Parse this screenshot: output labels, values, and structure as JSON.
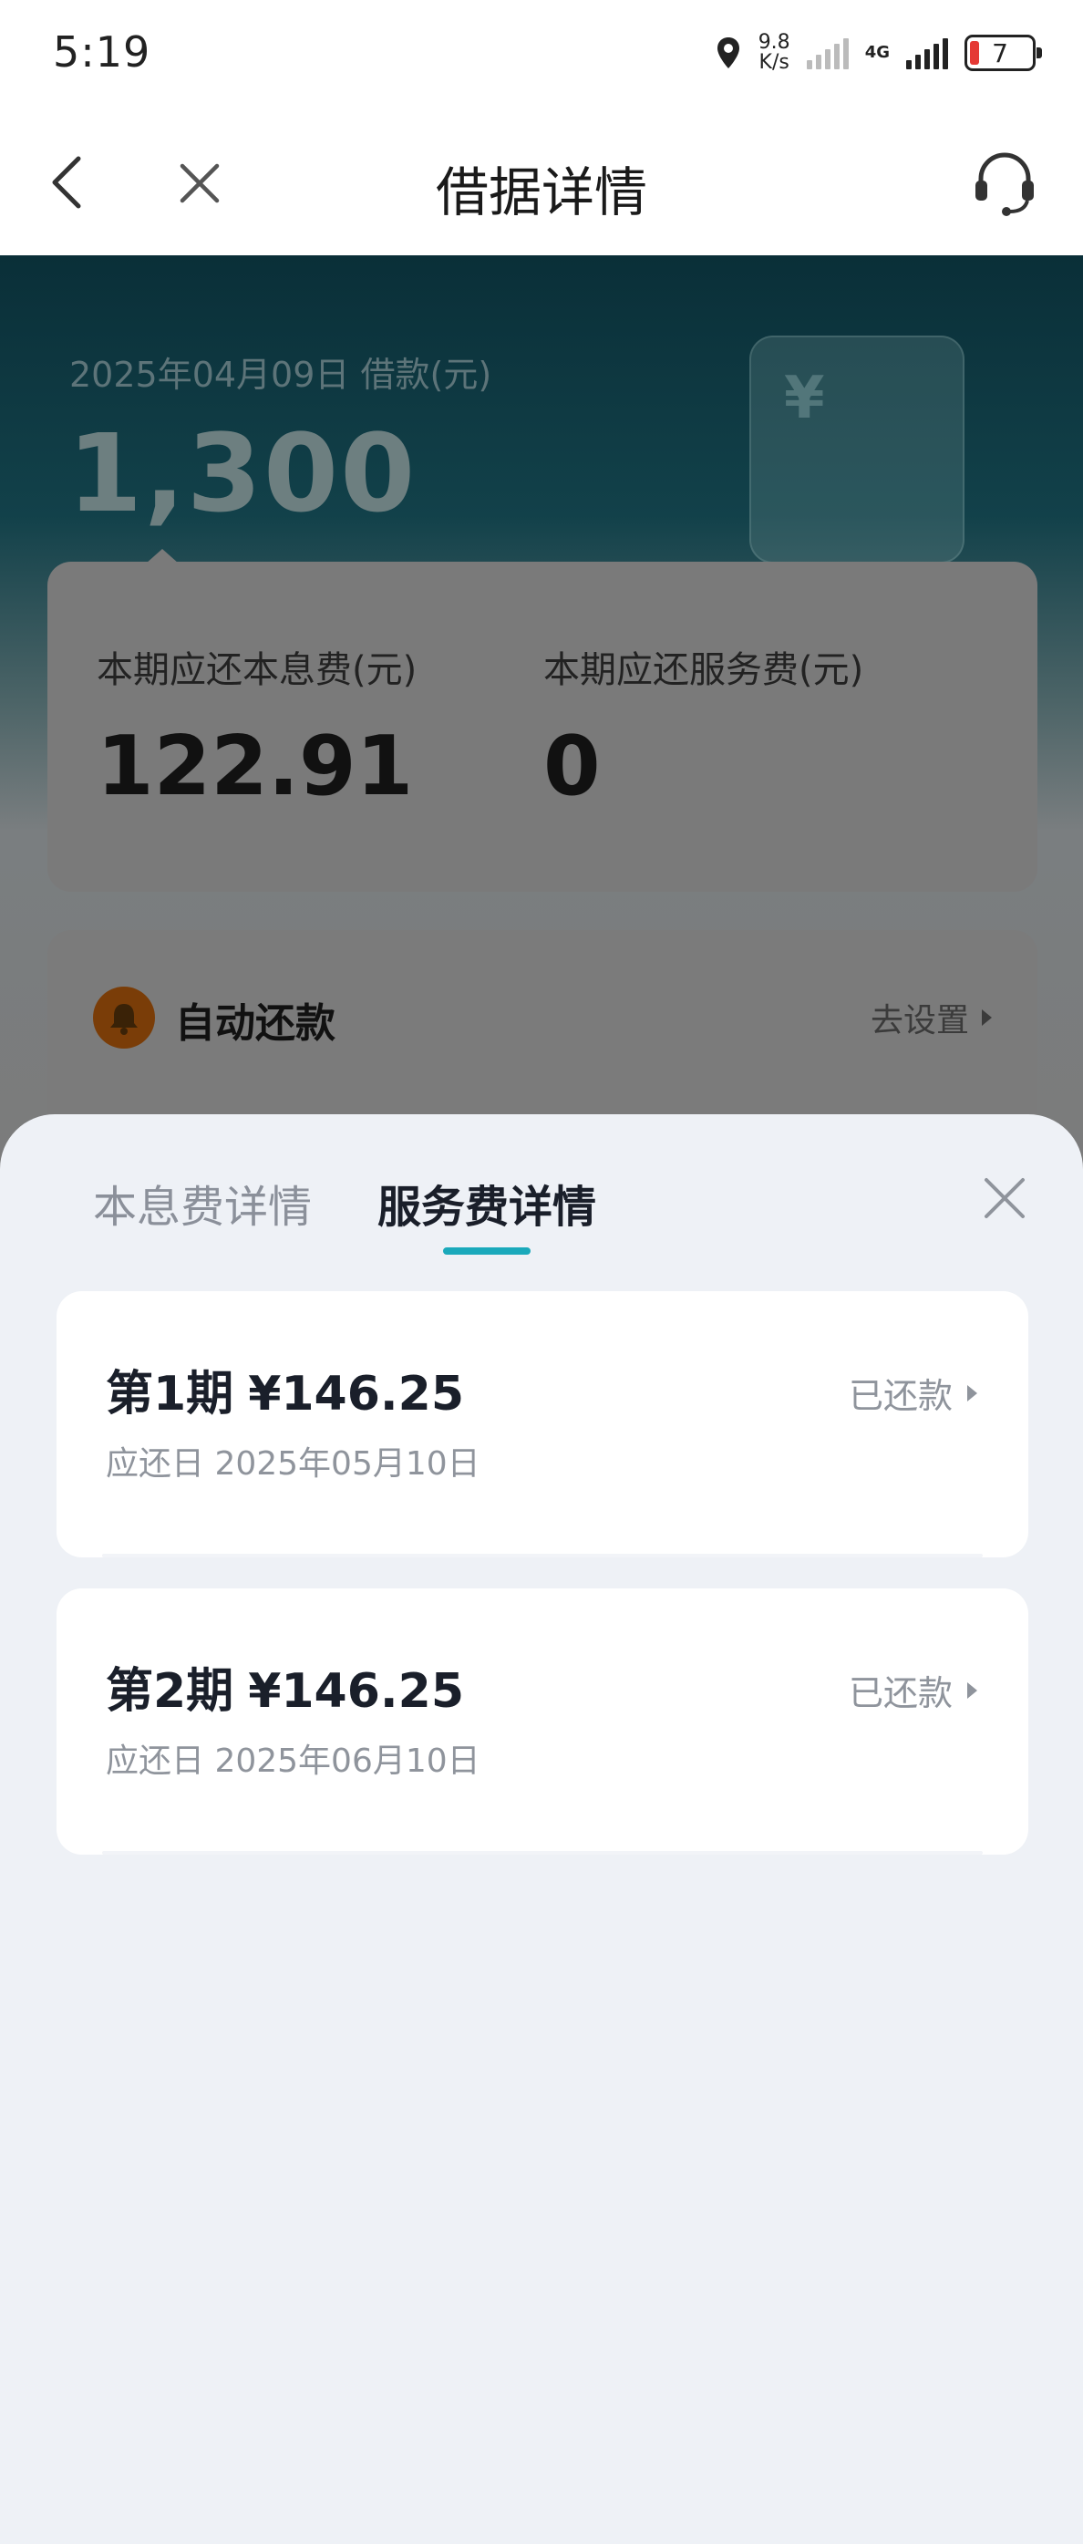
{
  "status_bar": {
    "time": "5:19",
    "speed_value": "9.8",
    "speed_unit": "K/s",
    "network": "4G",
    "battery": "7"
  },
  "nav": {
    "title": "借据详情",
    "back_icon": "chevron-left-icon",
    "close_icon": "close-icon",
    "service_icon": "customer-service-headset-icon"
  },
  "loan": {
    "date_label": "2025年04月09日 借款(元)",
    "amount": "1,300",
    "summary": {
      "principal_interest_label": "本期应还本息费(元)",
      "principal_interest_value": "122.91",
      "service_fee_label": "本期应还服务费(元)",
      "service_fee_value": "0"
    },
    "auto_repay": {
      "label": "自动还款",
      "setting_label": "去设置"
    }
  },
  "sheet": {
    "tabs": [
      {
        "label": "本息费详情",
        "active": false
      },
      {
        "label": "服务费详情",
        "active": true
      }
    ],
    "periods": [
      {
        "period": "第1期",
        "amount": "¥146.25",
        "due_date": "应还日 2025年05月10日",
        "status": "已还款"
      },
      {
        "period": "第2期",
        "amount": "¥146.25",
        "due_date": "应还日 2025年06月10日",
        "status": "已还款"
      }
    ]
  },
  "colors": {
    "accent": "#1aa9bb",
    "hero_bg_top": "#0a2f38",
    "sheet_bg": "#eef1f6",
    "muted_text": "#8f949c",
    "battery_low": "#e53935"
  }
}
